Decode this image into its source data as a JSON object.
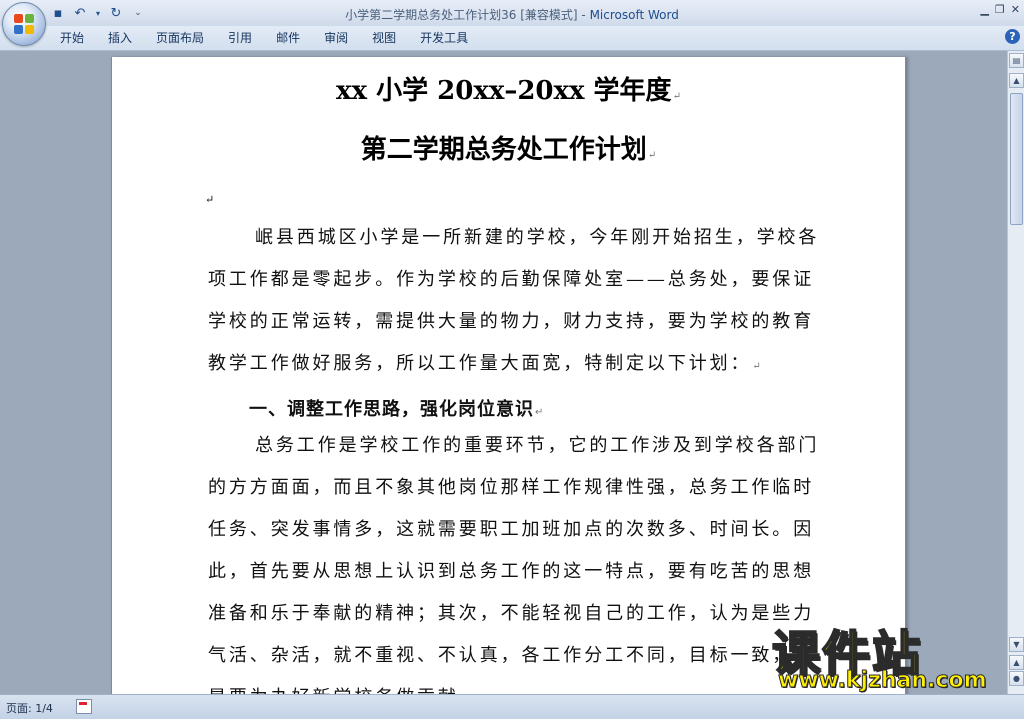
{
  "window": {
    "title_doc": "小学第二学期总务处工作计划36 [兼容模式] - ",
    "title_app": "Microsoft Word"
  },
  "ribbon_tabs": [
    "开始",
    "插入",
    "页面布局",
    "引用",
    "邮件",
    "审阅",
    "视图",
    "开发工具"
  ],
  "document": {
    "title_line1": "xx 小学 20xx–20xx 学年度",
    "title_line2": "第二学期总务处工作计划",
    "lines": [
      "岷县西城区小学是一所新建的学校，今年刚开始招生，学校各",
      "项工作都是零起步。作为学校的后勤保障处室——总务处，要保证",
      "学校的正常运转，需提供大量的物力，财力支持，要为学校的教育",
      "教学工作做好服务，所以工作量大面宽，特制定以下计划：",
      "总务工作是学校工作的重要环节，它的工作涉及到学校各部门",
      "的方方面面，而且不象其他岗位那样工作规律性强，总务工作临时",
      "任务、突发事情多，这就需要职工加班加点的次数多、时间长。因",
      "此，首先要从思想上认识到总务工作的这一特点，要有吃苦的思想",
      "准备和乐于奉献的精神；其次，不能轻视自己的工作，认为是些力",
      "气活、杂活，就不重视、不认真，各工作分工不同，目标一致，都",
      "是要为办好新学校务做贡献"
    ],
    "heading1": "一、调整工作思路，强化岗位意识"
  },
  "status": {
    "page": "页面: 1/4"
  },
  "watermark": {
    "main": "课件站",
    "url": "www.kjzhan.com"
  },
  "colors": {
    "accent": "#1f4e8c",
    "watermark_yellow": "#ffef00"
  }
}
